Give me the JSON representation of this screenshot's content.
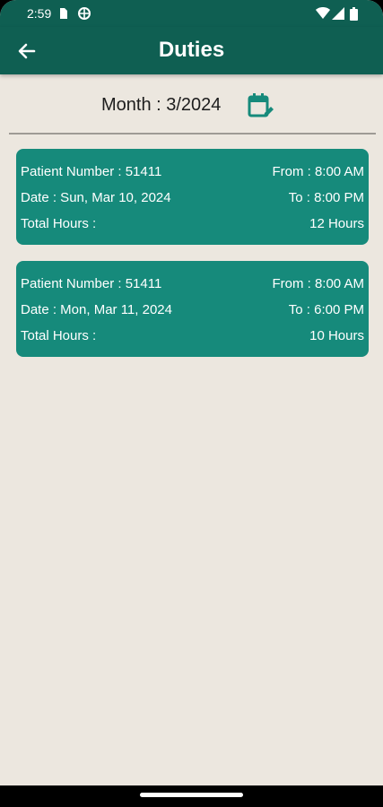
{
  "status_bar": {
    "time": "2:59"
  },
  "app_bar": {
    "title": "Duties"
  },
  "month": {
    "label": "Month : 3/2024"
  },
  "duties": [
    {
      "patient": "Patient Number : 51411",
      "from": "From : 8:00 AM",
      "date": "Date : Sun, Mar 10, 2024",
      "to": "To : 8:00 PM",
      "total_label": "Total Hours :",
      "total_value": "12 Hours"
    },
    {
      "patient": "Patient Number : 51411",
      "from": "From : 8:00 AM",
      "date": "Date : Mon, Mar 11, 2024",
      "to": "To : 6:00 PM",
      "total_label": "Total Hours :",
      "total_value": "10 Hours"
    }
  ],
  "colors": {
    "primary": "#0f5f52",
    "card": "#168a7b",
    "background": "#ece7df",
    "accent_icon": "#168a7b"
  },
  "icons": [
    "back-arrow-icon",
    "calendar-edit-icon",
    "wifi-icon",
    "signal-icon",
    "battery-icon"
  ]
}
